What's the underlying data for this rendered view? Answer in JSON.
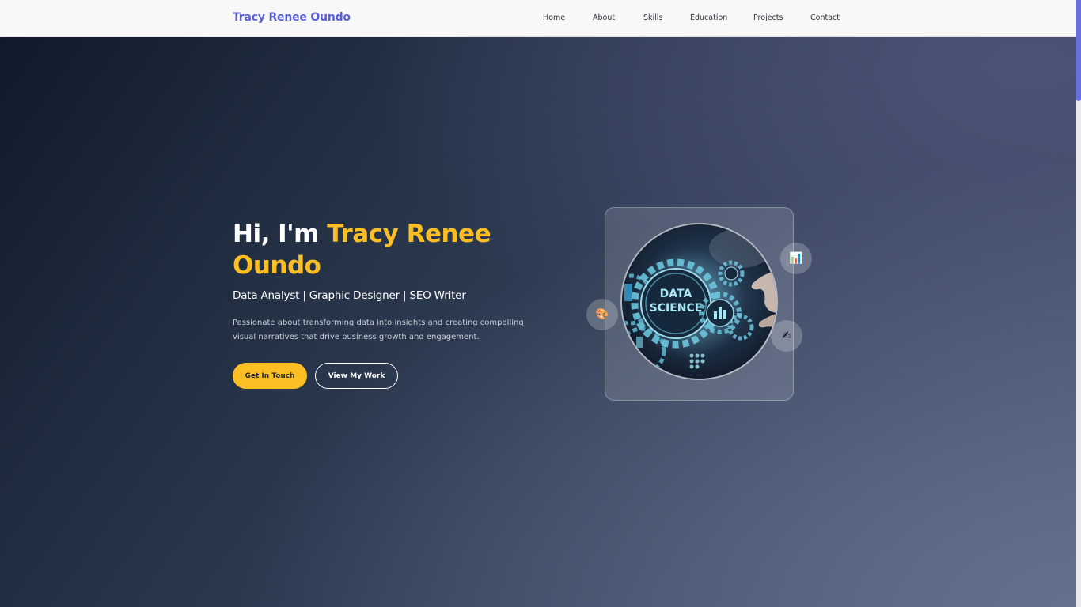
{
  "navbar": {
    "brand": "Tracy Renee Oundo",
    "links": [
      "Home",
      "About",
      "Skills",
      "Education",
      "Projects",
      "Contact"
    ]
  },
  "hero": {
    "greeting": "Hi, I'm ",
    "name": "Tracy Renee Oundo",
    "subtitle": "Data Analyst | Graphic Designer | SEO Writer",
    "description": "Passionate about transforming data into insights and creating compelling visual narratives that drive business growth and engagement.",
    "primary_button": "Get In Touch",
    "secondary_button": "View My Work"
  },
  "visual": {
    "image_text_line1": "DATA",
    "image_text_line2": "SCIENCE",
    "badges": [
      {
        "icon": "chart-icon",
        "glyph": "📊"
      },
      {
        "icon": "palette-icon",
        "glyph": "🎨"
      },
      {
        "icon": "writing-hand-icon",
        "glyph": "✍"
      }
    ]
  },
  "colors": {
    "brand": "#5b5fd6",
    "accent": "#fbbf24",
    "hero_dark": "#111a2c",
    "hero_light": "#64708d"
  }
}
